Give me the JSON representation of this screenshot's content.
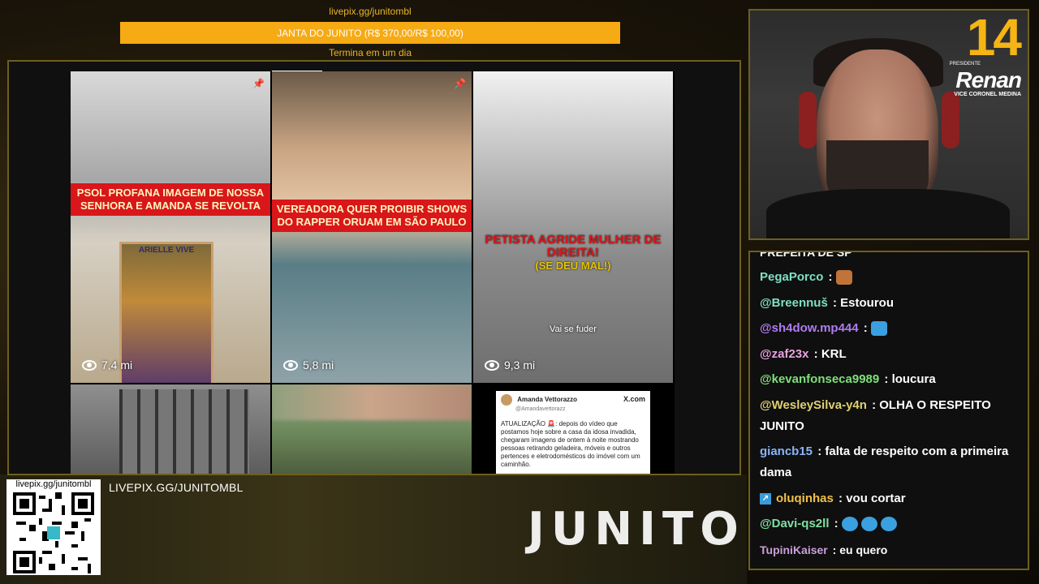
{
  "goal": {
    "link": "livepix.gg/junitombl",
    "title": "JANTA DO JUNITO (R$ 370,00/R$ 100,00)",
    "ends": "Termina em um dia"
  },
  "feed": {
    "tiles": [
      {
        "headline": "PSOL PROFANA IMAGEM DE NOSSA SENHORA E AMANDA SE REVOLTA",
        "views": "7,4 mi"
      },
      {
        "headline": "VEREADORA QUER PROIBIR SHOWS DO RAPPER ORUAM EM SÃO PAULO",
        "views": "5,8 mi"
      },
      {
        "headline": "PETISTA AGRIDE MULHER DE DIREITA!",
        "subheadline": "(SE DEU MAL!)",
        "caption": "Vai se fuder",
        "views": "9,3 mi"
      }
    ],
    "painting_label": "ARIELLE VIVE",
    "tweet": {
      "name": "Amanda Vettorazzo",
      "handle": "@Amandavettorazz",
      "site": "X.com",
      "body": "ATUALIZAÇÃO 🚨: depois do vídeo que postamos hoje sobre a casa da idosa invadida, chegaram imagens de ontem à noite mostrando pessoas retirando geladeira, móveis e outros pertences e eletrodomésticos do imóvel com um caminhão."
    }
  },
  "badge": {
    "number": "14",
    "presidente": "PRESIDENTE",
    "name": "Renan",
    "vice": "VICE CORONEL MEDINA"
  },
  "chat": {
    "top_partial": "PREFEITA DE SP",
    "messages": [
      {
        "user": "PegaPorco",
        "color": "#7fe0c4",
        "text": "",
        "emoji": "#c0743a"
      },
      {
        "user": "@Breennuš",
        "color": "#7fe0c4",
        "text": "Estourou"
      },
      {
        "user": "@sh4dow.mp444",
        "color": "#b07cf0",
        "text": "",
        "emoji": "#3aa0e0"
      },
      {
        "user": "@zaf23x",
        "color": "#e7a3e0",
        "text": "KRL"
      },
      {
        "user": "@kevanfonseca9989",
        "color": "#7fe07a",
        "text": "loucura"
      },
      {
        "user": "@WesleySilva-y4n",
        "color": "#e0d070",
        "text": "OLHA O RESPEITO JUNITO"
      },
      {
        "user": "giancb15",
        "color": "#8ab4f8",
        "text": "falta de respeito com a primeira dama"
      },
      {
        "user": "oluqinhas",
        "color": "#f0c04a",
        "text": "vou cortar",
        "mod": true
      },
      {
        "user": "@Davi-qs2ll",
        "color": "#7fe0a0",
        "text": "",
        "emojis": 3
      },
      {
        "user": "TupiniKaiser",
        "color": "#c9a0d8",
        "text": "eu quero"
      }
    ]
  },
  "footer": {
    "qr_label": "livepix.gg/junitombl",
    "pix_text": "LIVEPIX.GG/JUNITOMBL",
    "logo": "JUNITO"
  }
}
